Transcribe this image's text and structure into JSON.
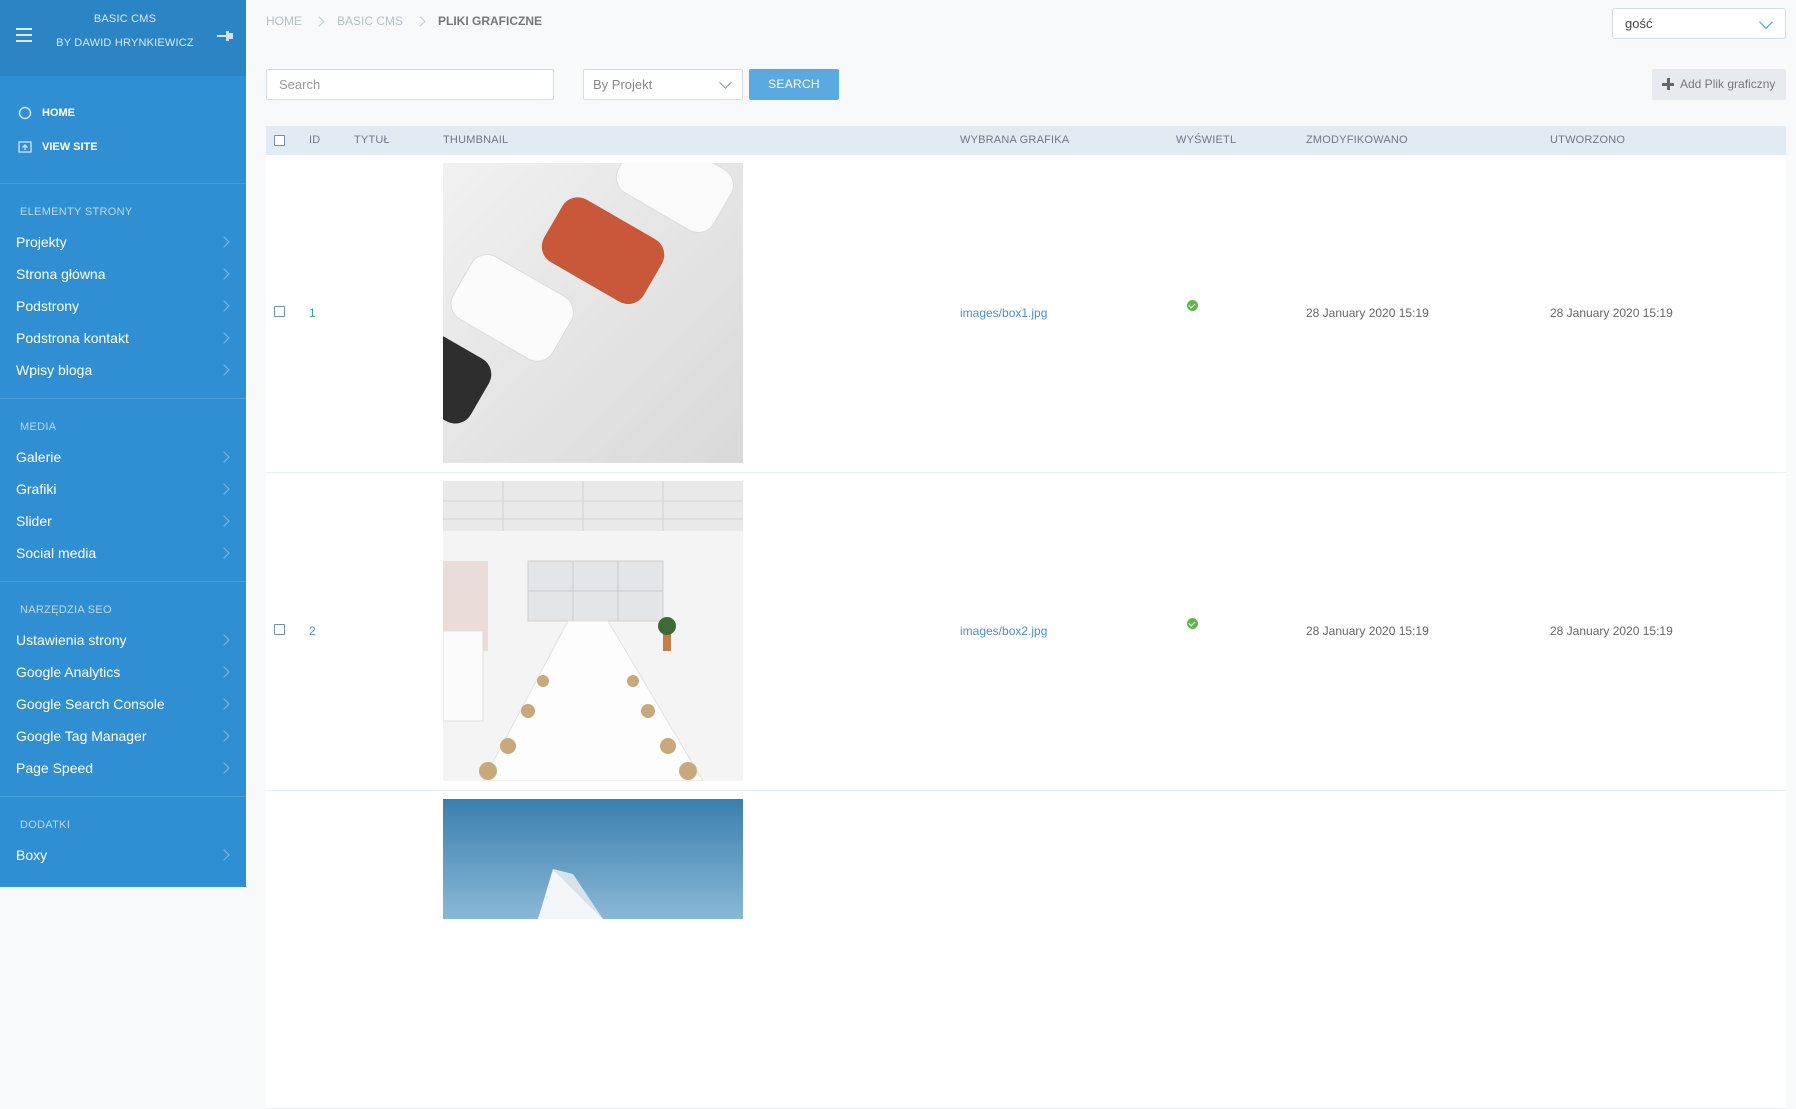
{
  "sidebar": {
    "brand_line1": "BASIC CMS",
    "brand_line2": "BY DAWID HRYNKIEWICZ",
    "quick": [
      {
        "label": "HOME",
        "icon": "circle-icon"
      },
      {
        "label": "VIEW SITE",
        "icon": "view-site-icon"
      }
    ],
    "sections": [
      {
        "title": "ELEMENTY STRONY",
        "items": [
          "Projekty",
          "Strona główna",
          "Podstrony",
          "Podstrona kontakt",
          "Wpisy bloga"
        ]
      },
      {
        "title": "MEDIA",
        "items": [
          "Galerie",
          "Grafiki",
          "Slider",
          "Social media"
        ]
      },
      {
        "title": "NARZĘDZIA SEO",
        "items": [
          "Ustawienia strony",
          "Google Analytics",
          "Google Search Console",
          "Google Tag Manager",
          "Page Speed"
        ]
      },
      {
        "title": "DODATKI",
        "items": [
          "Boxy"
        ]
      }
    ]
  },
  "breadcrumb": {
    "home": "HOME",
    "basic": "BASIC CMS",
    "current": "PLIKI GRAFICZNE"
  },
  "user": {
    "name": "gość"
  },
  "filters": {
    "search_placeholder": "Search",
    "project_select": "By Projekt",
    "search_button": "SEARCH",
    "add_button": "Add Plik graficzny"
  },
  "table": {
    "headers": {
      "id": "ID",
      "title": "TYTUŁ",
      "thumbnail": "THUMBNAIL",
      "file": "WYBRANA GRAFIKA",
      "display": "WYŚWIETL",
      "modified": "ZMODYFIKOWANO",
      "created": "UTWORZONO"
    },
    "rows": [
      {
        "id": "1",
        "file": "images/box1.jpg",
        "modified": "28 January 2020 15:19",
        "created": "28 January 2020 15:19",
        "display": true
      },
      {
        "id": "2",
        "file": "images/box2.jpg",
        "modified": "28 January 2020 15:19",
        "created": "28 January 2020 15:19",
        "display": true
      }
    ]
  },
  "colors": {
    "sidebar": "#2f8fd2",
    "accent": "#5aa9e0",
    "link": "#4a90d2",
    "success": "#5cb946"
  }
}
